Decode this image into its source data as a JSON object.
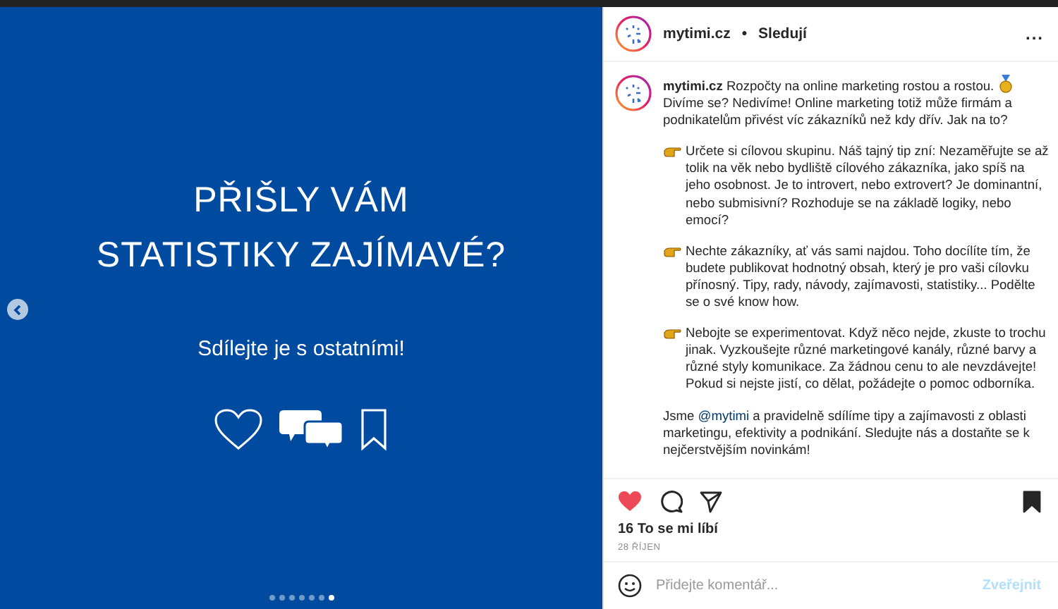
{
  "slide": {
    "title_lines": [
      "PŘIŠLY VÁM",
      "STATISTIKY ZAJÍMAVÉ?"
    ],
    "subtitle": "Sdílejte je s ostatními!",
    "dots": [
      {
        "selected": false
      },
      {
        "selected": false
      },
      {
        "selected": false
      },
      {
        "selected": false
      },
      {
        "selected": false
      },
      {
        "selected": false
      },
      {
        "selected": true
      }
    ]
  },
  "header": {
    "username": "mytimi.cz",
    "separator": "•",
    "follow": "Sledují",
    "more": "..."
  },
  "caption": {
    "username": "mytimi.cz",
    "intro_before_icon": "Rozpočty na online marketing rostou a rostou.",
    "intro_after_icon": "Divíme se? Nedivíme! Online marketing totiž může firmám a podnikatelům přivést víc zákazníků než kdy dřív. Jak na to?",
    "tips": [
      "Určete si cílovou skupinu. Náš tajný tip zní: Nezaměřujte se až tolik na věk nebo bydliště cílového zákazníka, jako spíš na jeho osobnost. Je to introvert, nebo extrovert? Je dominantní, nebo submisivní? Rozhoduje se na základě logiky, nebo emocí?",
      "Nechte zákazníky, ať vás sami najdou. Toho docílíte tím, že budete publikovat hodnotný obsah, který je pro vaši cílovku přínosný. Tipy, rady, návody, zajímavosti, statistiky... Podělte se o své know how.",
      "Nebojte se experimentovat. Když něco nejde, zkuste to trochu jinak. Vyzkoušejte různé marketingové kanály, různé barvy a různé styly komunikace. Za žádnou cenu to ale nevzdávejte! Pokud si nejste jistí, co dělat, požádejte o pomoc odborníka."
    ],
    "outro_before": "Jsme",
    "mention": "@mytimi",
    "outro_after": "a pravidelně sdílíme tipy a zajímavosti z oblasti marketingu, efektivity a podnikání. Sledujte nás a dostaňte se k nejčerstvějším novinkám!"
  },
  "actions": {
    "liked": true,
    "saved": true
  },
  "likes": "16 To se mi líbí",
  "date": "28 ŘÍJEN",
  "comment": {
    "placeholder": "Přidejte komentář...",
    "post": "Zveřejnit"
  }
}
